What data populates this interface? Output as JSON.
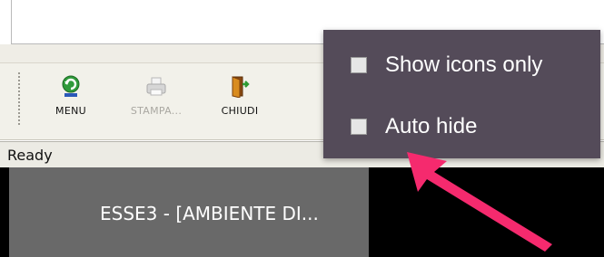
{
  "toolbar": {
    "buttons": [
      {
        "label": "MENU",
        "icon": "menu-refresh-icon",
        "enabled": true
      },
      {
        "label": "STAMPA...",
        "icon": "printer-icon",
        "enabled": false
      },
      {
        "label": "CHIUDI",
        "icon": "exit-door-icon",
        "enabled": true
      }
    ]
  },
  "status": {
    "text": "Ready"
  },
  "taskbar": {
    "item_label": "ESSE3 - [AMBIENTE DI..."
  },
  "popup": {
    "items": [
      {
        "label": "Show icons only",
        "checked": false
      },
      {
        "label": "Auto hide",
        "checked": false
      }
    ]
  },
  "colors": {
    "popup_bg": "#544b59",
    "arrow": "#f52a6e",
    "taskbar_bg": "#000000",
    "task_button_bg": "#696969"
  }
}
